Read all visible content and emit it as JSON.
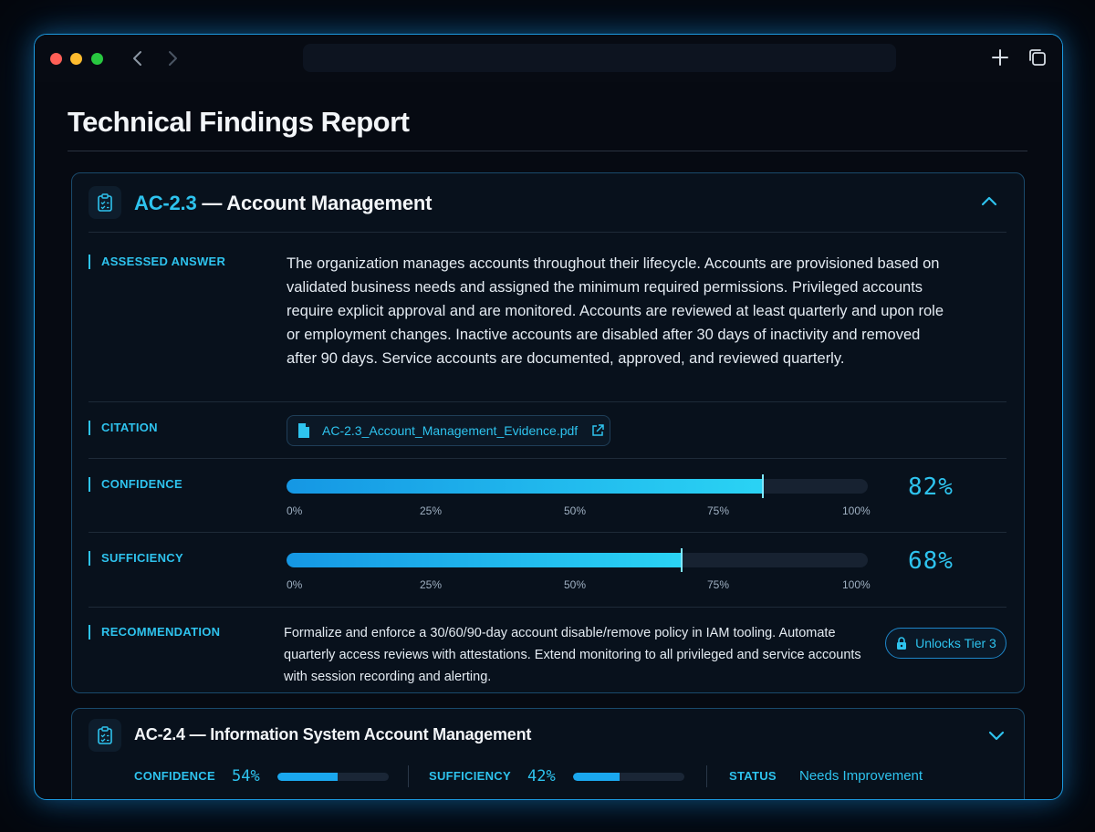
{
  "page_title": "Technical Findings Report",
  "icons": {
    "back": "chevron-left-icon",
    "forward": "chevron-right-icon",
    "new_tab": "plus-icon",
    "tabs": "tabs-icon",
    "finding": "clipboard-check-icon",
    "collapse": "chevron-up-icon",
    "expand": "chevron-down-icon",
    "file": "document-icon",
    "external": "external-link-icon",
    "lock": "lock-icon"
  },
  "colors": {
    "accent": "#2ec3ee",
    "border_glow": "#1c9ae0",
    "background": "#04070d"
  },
  "findings": [
    {
      "code": "AC-2.3",
      "title": " — Account Management",
      "expanded": true,
      "assessed_answer_label": "ASSESSED ANSWER",
      "assessed_answer": "The organization manages accounts throughout their lifecycle. Accounts are provisioned based on validated business needs and assigned the minimum required permissions. Privileged accounts require explicit approval and are monitored. Accounts are reviewed at least quarterly and upon role or employment changes. Inactive accounts are disabled after 30 days of inactivity and removed after 90 days. Service accounts are documented, approved, and reviewed quarterly.",
      "citation_label": "CITATION",
      "citation_file": "AC-2.3_Account_Management_Evidence.pdf",
      "confidence_label": "CONFIDENCE",
      "confidence": 0.82,
      "confidence_text": "82%",
      "sufficiency_label": "SUFFICIENCY",
      "sufficiency": 0.68,
      "sufficiency_text": "68%",
      "scale_ticks": [
        "0%",
        "25%",
        "50%",
        "75%",
        "100%"
      ],
      "recommendation_label": "RECOMMENDATION",
      "recommendation": "Formalize and enforce a 30/60/90-day account disable/remove policy in IAM tooling. Automate quarterly access reviews with attestations. Extend monitoring to all privileged and service accounts with session recording and alerting.",
      "unlock_label": "Unlocks Tier 3"
    },
    {
      "title": "AC-2.4 — Information System Account Management",
      "expanded": false,
      "confidence_label": "CONFIDENCE",
      "confidence": 0.54,
      "confidence_text": "54%",
      "sufficiency_label": "SUFFICIENCY",
      "sufficiency": 0.42,
      "sufficiency_text": "42%",
      "status_label": "STATUS",
      "status_value": "Needs Improvement"
    }
  ]
}
